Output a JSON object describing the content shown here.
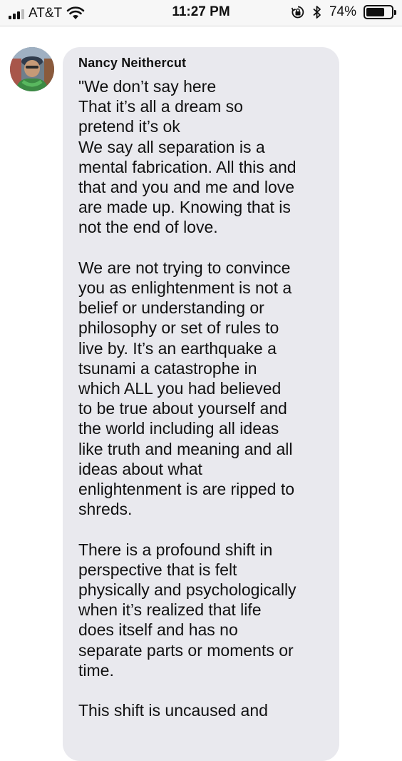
{
  "status_bar": {
    "carrier": "AT&T",
    "time": "11:27 PM",
    "battery_percent": "74%",
    "battery_level": 0.74
  },
  "message": {
    "sender": "Nancy Neithercut",
    "paragraphs": [
      "\"We don’t say here\nThat it’s all a dream so\npretend it’s ok\nWe say all separation is a\nmental fabrication. All this and\nthat and you and me and love\nare made up. Knowing that is\nnot the end of love.",
      "We are not trying to convince\nyou as enlightenment is not a\nbelief or understanding or\nphilosophy or set of rules to\nlive by. It’s an earthquake a\ntsunami a catastrophe in\nwhich ALL you had believed\nto be true about yourself and\nthe world including all ideas\nlike truth and meaning and all\nideas about what\nenlightenment is are ripped to\nshreds.",
      "There is a profound shift in\nperspective that is felt\nphysically and psychologically\nwhen it’s realized that life\ndoes itself and has no\nseparate parts or moments or\ntime.",
      "This shift is uncaused and"
    ]
  }
}
